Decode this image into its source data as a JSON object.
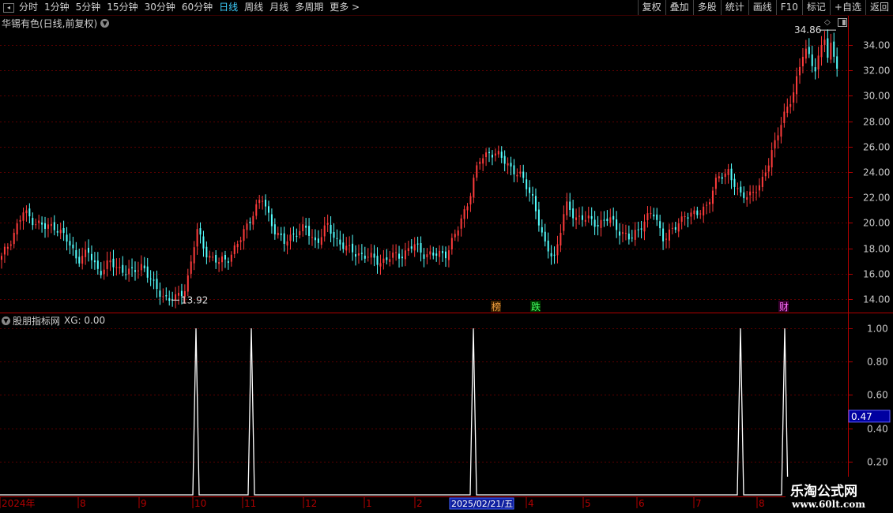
{
  "toolbar": {
    "periods": [
      "分时",
      "1分钟",
      "5分钟",
      "15分钟",
      "30分钟",
      "60分钟",
      "日线",
      "周线",
      "月线",
      "多周期",
      "更多 >"
    ],
    "active_period": "日线",
    "buttons": [
      "复权",
      "叠加",
      "多股",
      "统计",
      "画线",
      "F10",
      "标记",
      "+自选",
      "返回"
    ]
  },
  "main_title": "华锡有色(日线,前复权)",
  "indicator": {
    "name": "股朋指标网",
    "value_label": "XG: 0.00"
  },
  "price_axis": {
    "ticks": [
      "34.00",
      "32.00",
      "30.00",
      "28.00",
      "26.00",
      "24.00",
      "22.00",
      "20.00",
      "18.00",
      "16.00",
      "14.00"
    ]
  },
  "indicator_axis": {
    "ticks": [
      "1.00",
      "0.80",
      "0.60",
      "0.40",
      "0.20"
    ],
    "cursor_value": "0.47"
  },
  "annotations": {
    "high": "34.86",
    "low": "13.92"
  },
  "markers": {
    "bang": "榜",
    "die": "跌",
    "cai": "财"
  },
  "date_axis": {
    "labels": [
      "2024年",
      "8",
      "9",
      "10",
      "11",
      "12",
      "1",
      "2",
      "4",
      "5",
      "6",
      "7",
      "8"
    ],
    "cursor_date": "2025/02/21/五"
  },
  "watermark": {
    "line1": "乐淘公式网",
    "line2": "www.60lt.com"
  },
  "colors": {
    "up": "#ff3c3c",
    "down": "#54ffff",
    "grid": "#5a0000",
    "axis": "#b00000",
    "line": "#ffffff",
    "accent": "#3fd0ff"
  },
  "chart_data": {
    "type": "candlestick",
    "title": "华锡有色(日线,前复权)",
    "ylim": [
      13.0,
      35.5
    ],
    "price_keypoints": [
      17.2,
      19.0,
      20.8,
      20.2,
      19.6,
      19.8,
      18.6,
      17.2,
      17.6,
      16.2,
      16.8,
      16.4,
      16.0,
      16.8,
      15.0,
      14.2,
      13.92,
      15.0,
      19.3,
      17.5,
      16.8,
      17.4,
      18.6,
      20.6,
      21.9,
      19.8,
      18.3,
      19.3,
      19.5,
      18.5,
      19.7,
      18.6,
      17.8,
      17.6,
      17.2,
      17.0,
      17.3,
      17.6,
      18.2,
      17.6,
      17.4,
      17.7,
      19.3,
      21.8,
      24.8,
      25.7,
      25.1,
      24.4,
      23.4,
      22.0,
      18.2,
      17.4,
      21.3,
      20.5,
      20.2,
      20.0,
      20.3,
      19.4,
      18.6,
      20.0,
      20.8,
      18.9,
      19.4,
      20.8,
      20.5,
      21.5,
      23.4,
      24.2,
      22.0,
      22.4,
      22.8,
      25.8,
      28.0,
      30.5,
      33.6,
      32.3,
      34.86,
      32.6
    ],
    "signals": {
      "series": "XG",
      "spike_dates": [
        "2024/10",
        "2024/11",
        "2025/02/21",
        "2025/07",
        "2025/08"
      ],
      "spike_value": 1.0,
      "baseline": 0.0
    }
  }
}
